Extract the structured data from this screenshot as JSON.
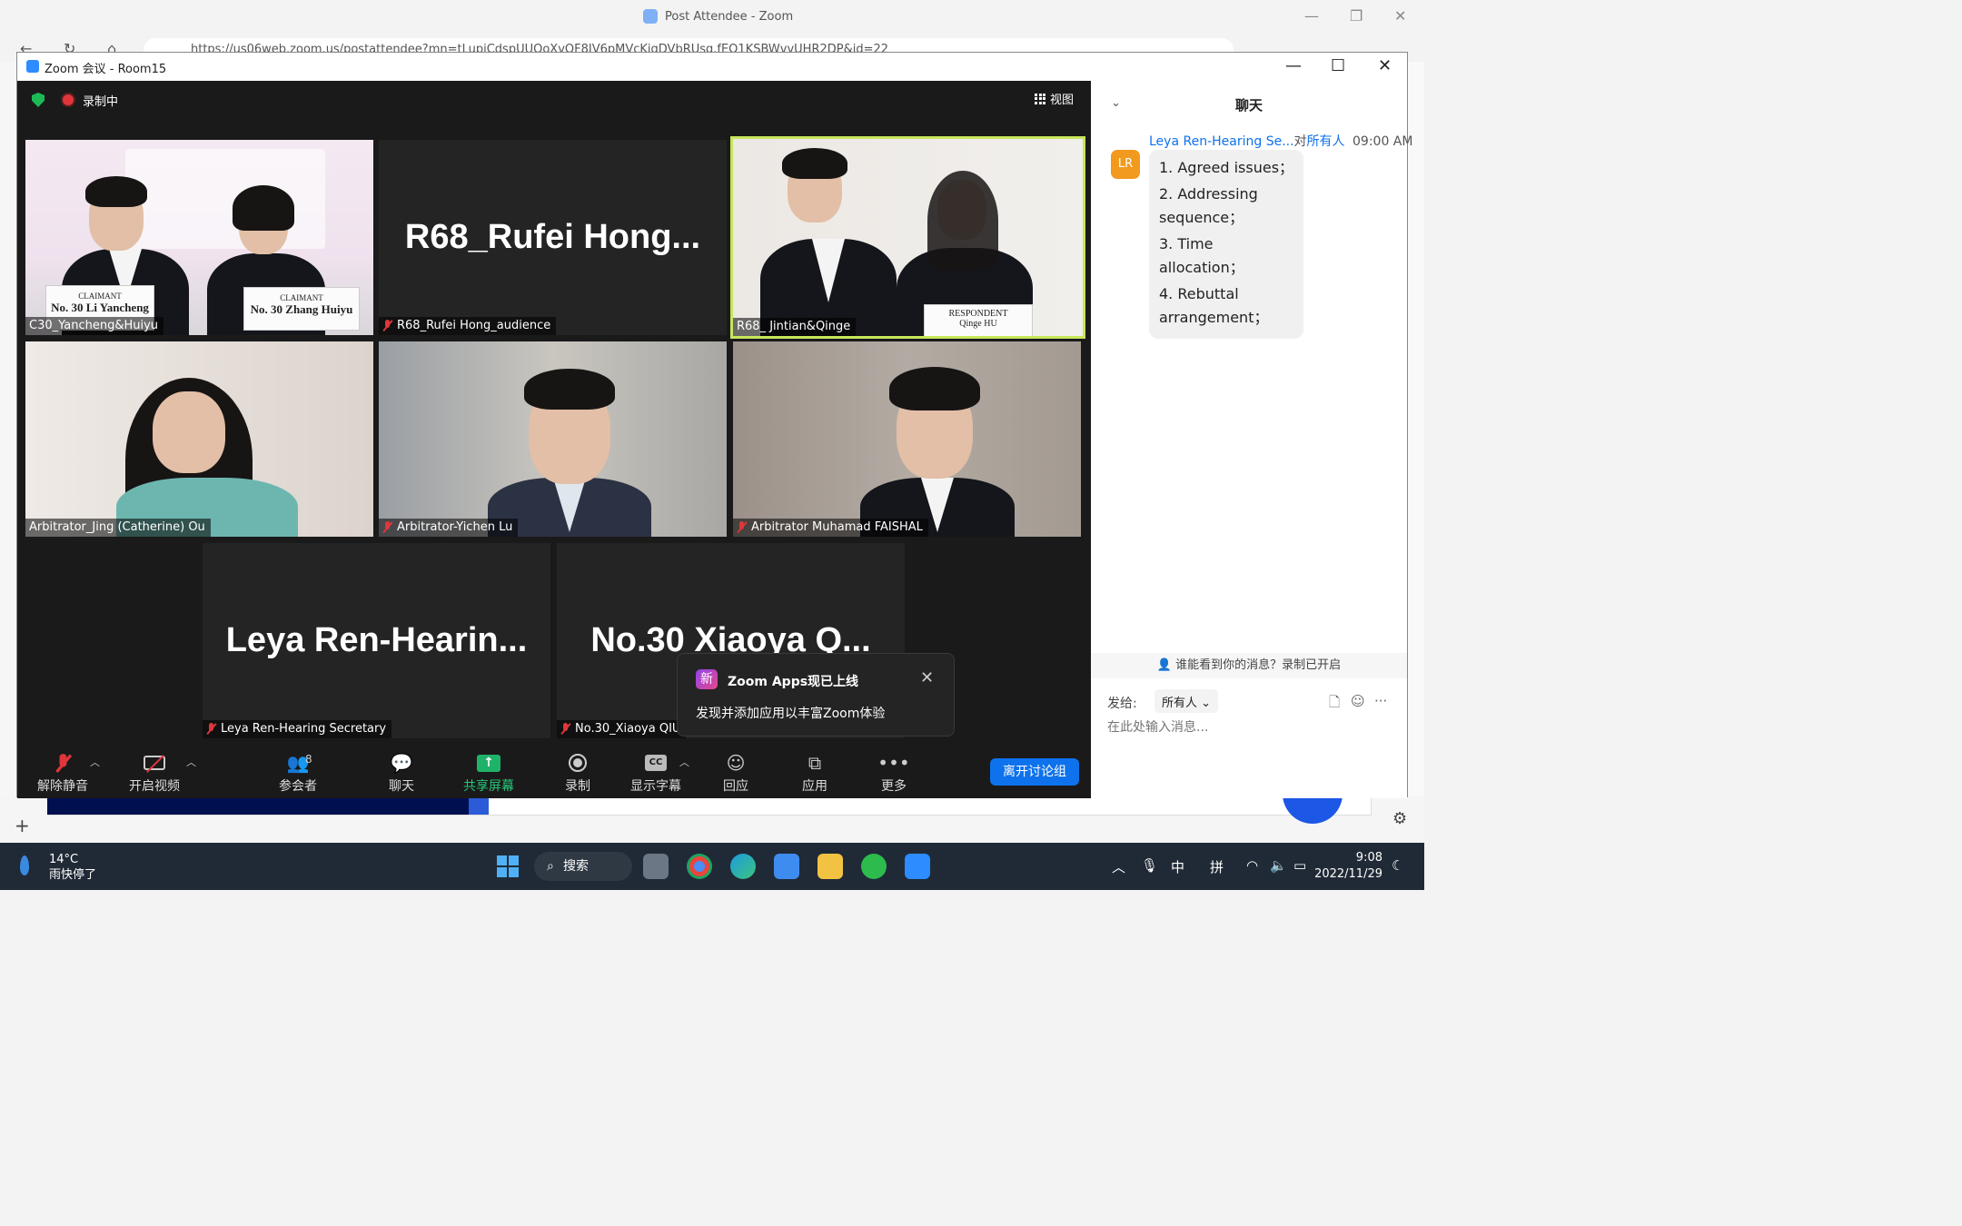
{
  "browser": {
    "tab_title": "Post Attendee - Zoom",
    "url": "https://us06web.zoom.us/postattendee?mn=tLupiCdspUUOoXvOF8IV6pMVcKiqDVbRUsq.fEQ1KSBWvvUHR2DP&id=22"
  },
  "window": {
    "title": "Zoom 会议 - Room15",
    "minimize": "—",
    "maximize": "☐",
    "close": "✕"
  },
  "meeting": {
    "recording_label": "录制中",
    "view_label": "视图",
    "tiles": [
      {
        "name": "C30_Yancheng&Huiyu",
        "big_name": "",
        "muted": false,
        "active": false,
        "placard_left_role": "CLAIMANT",
        "placard_left_name": "No. 30 Li Yancheng",
        "placard_right_role": "CLAIMANT",
        "placard_right_name": "No. 30 Zhang Huiyu"
      },
      {
        "name": "R68_Rufei Hong_audience",
        "big_name": "R68_Rufei  Hong...",
        "muted": true,
        "active": false
      },
      {
        "name": "R68_ Jintian&Qinge",
        "big_name": "",
        "muted": false,
        "active": true,
        "placard_right_role": "RESPONDENT",
        "placard_right_name": "Qinge HU"
      },
      {
        "name": "Arbitrator_Jing (Catherine) Ou",
        "big_name": "",
        "muted": false,
        "active": false
      },
      {
        "name": "Arbitrator-Yichen Lu",
        "big_name": "",
        "muted": true,
        "active": false
      },
      {
        "name": "Arbitrator Muhamad FAISHAL",
        "big_name": "",
        "muted": true,
        "active": false
      },
      {
        "name": "Leya Ren-Hearing Secretary",
        "big_name": "Leya  Ren-Hearin...",
        "muted": true,
        "active": false
      },
      {
        "name": "No.30_Xiaoya QIU",
        "big_name": "No.30  Xiaoya  Q...",
        "muted": true,
        "active": false
      }
    ]
  },
  "toast": {
    "badge": "新",
    "title": "Zoom Apps现已上线",
    "description": "发现并添加应用以丰富Zoom体验"
  },
  "toolbar": {
    "unmute": "解除静音",
    "start_video": "开启视频",
    "participants": "参会者",
    "participants_count": "8",
    "chat": "聊天",
    "share_screen": "共享屏幕",
    "share_icon": "↑",
    "record": "录制",
    "captions": "显示字幕",
    "captions_icon": "CC",
    "reactions": "回应",
    "apps": "应用",
    "more": "更多",
    "leave_room": "离开讨论组"
  },
  "chat": {
    "title": "聊天",
    "sender": "Leya Ren-Hearing Se...",
    "to_prefix": "对",
    "to": "所有人",
    "time": "09:00 AM",
    "avatar_initials": "LR",
    "message_lines": [
      "1. Agreed issues；",
      "2. Addressing sequence；",
      "3. Time allocation；",
      "4. Rebuttal arrangement；"
    ],
    "visibility_notice": "谁能看到你的消息？录制已开启",
    "send_to_label": "发给:",
    "recipient": "所有人",
    "input_placeholder": "在此处输入消息..."
  },
  "taskbar": {
    "temperature": "14°C",
    "weather": "雨快停了",
    "search": "搜索",
    "ime_lang": "中",
    "ime_mode": "拼",
    "time": "9:08",
    "date": "2022/11/29"
  },
  "colors": {
    "zoom_blue": "#0e72ed",
    "share_green": "#27c97a",
    "active_speaker": "#c8e65b",
    "muted_red": "#e0363a",
    "avatar_orange": "#f19a1d"
  }
}
